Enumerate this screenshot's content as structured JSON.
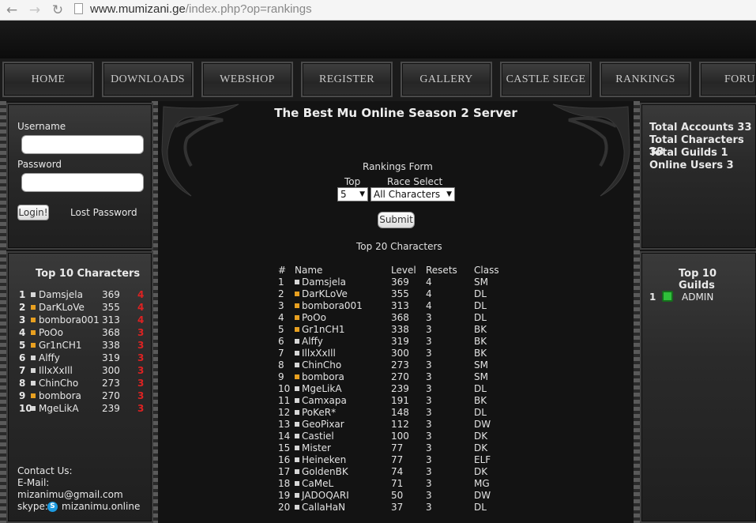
{
  "browser": {
    "url_host": "www.mumizani.ge",
    "url_path": "/index.php?op=rankings"
  },
  "menu": [
    "HOME",
    "DOWNLOADS",
    "WEBSHOP",
    "REGISTER",
    "GALLERY",
    "CASTLE SIEGE",
    "RANKINGS",
    "FORU"
  ],
  "login": {
    "username_label": "Username",
    "password_label": "Password",
    "login_button": "Login!",
    "lost_password": "Lost Password"
  },
  "top10": {
    "title": "Top 10 Characters",
    "rows": [
      {
        "rank": "1",
        "name": "Damsjela",
        "level": "369",
        "resets": "4",
        "color": "#d8d8d8"
      },
      {
        "rank": "2",
        "name": "DarKLoVe",
        "level": "355",
        "resets": "4",
        "color": "#e8a020"
      },
      {
        "rank": "3",
        "name": "bombora001",
        "level": "313",
        "resets": "4",
        "color": "#e8a020"
      },
      {
        "rank": "4",
        "name": "PoOo",
        "level": "368",
        "resets": "3",
        "color": "#e8a020"
      },
      {
        "rank": "5",
        "name": "Gr1nCH1",
        "level": "338",
        "resets": "3",
        "color": "#e8a020"
      },
      {
        "rank": "6",
        "name": "Alffy",
        "level": "319",
        "resets": "3",
        "color": "#d8d8d8"
      },
      {
        "rank": "7",
        "name": "IllxXxIll",
        "level": "300",
        "resets": "3",
        "color": "#d8d8d8"
      },
      {
        "rank": "8",
        "name": "ChinCho",
        "level": "273",
        "resets": "3",
        "color": "#d8d8d8"
      },
      {
        "rank": "9",
        "name": "bombora",
        "level": "270",
        "resets": "3",
        "color": "#e8a020"
      },
      {
        "rank": "10",
        "name": "MgeLikA",
        "level": "239",
        "resets": "3",
        "color": "#d8d8d8"
      }
    ]
  },
  "contact": {
    "title": "Contact Us:",
    "email_label": "E-Mail:",
    "email": "mizanimu@gmail.com",
    "skype_label": "skype:",
    "skype": "mizanimu.online"
  },
  "center": {
    "title": "The Best Mu Online Season 2 Server",
    "form_title": "Rankings Form",
    "top_label": "Top",
    "race_label": "Race Select",
    "top_value": "5",
    "race_value": "All Characters",
    "submit": "Submit",
    "table_title": "Top 20 Characters",
    "headers": [
      "#",
      "Name",
      "Level",
      "Resets",
      "Class"
    ],
    "rows": [
      {
        "n": "1",
        "name": "Damsjela",
        "level": "369",
        "resets": "4",
        "cls": "SM",
        "color": "#d8d8d8"
      },
      {
        "n": "2",
        "name": "DarKLoVe",
        "level": "355",
        "resets": "4",
        "cls": "DL",
        "color": "#e8a020"
      },
      {
        "n": "3",
        "name": "bombora001",
        "level": "313",
        "resets": "4",
        "cls": "DL",
        "color": "#e8a020"
      },
      {
        "n": "4",
        "name": "PoOo",
        "level": "368",
        "resets": "3",
        "cls": "DL",
        "color": "#e8a020"
      },
      {
        "n": "5",
        "name": "Gr1nCH1",
        "level": "338",
        "resets": "3",
        "cls": "BK",
        "color": "#e8a020"
      },
      {
        "n": "6",
        "name": "Alffy",
        "level": "319",
        "resets": "3",
        "cls": "BK",
        "color": "#d8d8d8"
      },
      {
        "n": "7",
        "name": "IllxXxIll",
        "level": "300",
        "resets": "3",
        "cls": "BK",
        "color": "#d8d8d8"
      },
      {
        "n": "8",
        "name": "ChinCho",
        "level": "273",
        "resets": "3",
        "cls": "SM",
        "color": "#d8d8d8"
      },
      {
        "n": "9",
        "name": "bombora",
        "level": "270",
        "resets": "3",
        "cls": "SM",
        "color": "#e8a020"
      },
      {
        "n": "10",
        "name": "MgeLikA",
        "level": "239",
        "resets": "3",
        "cls": "DL",
        "color": "#d8d8d8"
      },
      {
        "n": "11",
        "name": "Camxapa",
        "level": "191",
        "resets": "3",
        "cls": "BK",
        "color": "#d8d8d8"
      },
      {
        "n": "12",
        "name": "PoKeR*",
        "level": "148",
        "resets": "3",
        "cls": "DL",
        "color": "#d8d8d8"
      },
      {
        "n": "13",
        "name": "GeoPixar",
        "level": "112",
        "resets": "3",
        "cls": "DW",
        "color": "#d8d8d8"
      },
      {
        "n": "14",
        "name": "Castiel",
        "level": "100",
        "resets": "3",
        "cls": "DK",
        "color": "#d8d8d8"
      },
      {
        "n": "15",
        "name": "Mister",
        "level": "77",
        "resets": "3",
        "cls": "DK",
        "color": "#d8d8d8"
      },
      {
        "n": "16",
        "name": "Heineken",
        "level": "77",
        "resets": "3",
        "cls": "ELF",
        "color": "#d8d8d8"
      },
      {
        "n": "17",
        "name": "GoldenBK",
        "level": "74",
        "resets": "3",
        "cls": "DK",
        "color": "#d8d8d8"
      },
      {
        "n": "18",
        "name": "CaMeL",
        "level": "71",
        "resets": "3",
        "cls": "MG",
        "color": "#d8d8d8"
      },
      {
        "n": "19",
        "name": "JADOQARI",
        "level": "50",
        "resets": "3",
        "cls": "DW",
        "color": "#d8d8d8"
      },
      {
        "n": "20",
        "name": "CallaHaN",
        "level": "37",
        "resets": "3",
        "cls": "DL",
        "color": "#d8d8d8"
      }
    ]
  },
  "stats": {
    "accounts": "Total Accounts 33",
    "characters": "Total Characters 38",
    "guilds": "Total Guilds 1",
    "online": "Online Users 3"
  },
  "guilds": {
    "title": "Top 10 Guilds",
    "rows": [
      {
        "rank": "1",
        "name": "ADMIN"
      }
    ]
  },
  "colors": {
    "accent_orange": "#e8a020",
    "reset_red": "#d22",
    "guild_green": "#2fbf3a"
  }
}
